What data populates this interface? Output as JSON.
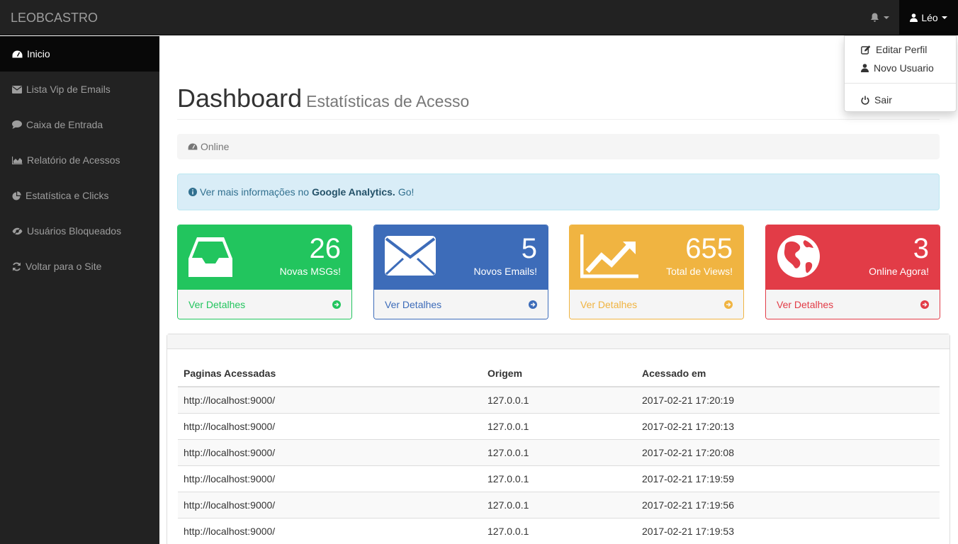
{
  "navbar": {
    "brand": "LEOBCASTRO",
    "user_label": "Léo"
  },
  "user_menu": {
    "items": [
      {
        "label": "Editar Perfil",
        "icon": "edit-icon"
      },
      {
        "label": "Novo Usuario",
        "icon": "user-icon"
      },
      {
        "label": "Sair",
        "icon": "power-icon"
      }
    ]
  },
  "sidebar": {
    "items": [
      {
        "label": "Inicio",
        "icon": "dashboard-icon",
        "active": true
      },
      {
        "label": "Lista Vip de Emails",
        "icon": "envelope-icon"
      },
      {
        "label": "Caixa de Entrada",
        "icon": "comment-icon"
      },
      {
        "label": "Relatório de Acessos",
        "icon": "area-chart-icon"
      },
      {
        "label": "Estatística e Clicks",
        "icon": "pie-chart-icon"
      },
      {
        "label": "Usuários Bloqueados",
        "icon": "eye-slash-icon"
      },
      {
        "label": "Voltar para o Site",
        "icon": "refresh-icon"
      }
    ]
  },
  "header": {
    "title": "Dashboard",
    "subtitle": "Estatísticas de Acesso"
  },
  "breadcrumb": {
    "label": "Online"
  },
  "alert": {
    "prefix": "Ver mais informações no",
    "strong": "Google Analytics.",
    "link": "Go!"
  },
  "panels": [
    {
      "value": "26",
      "label": "Novas MSGs!",
      "footer": "Ver Detalhes",
      "color": "#22c55e",
      "icon": "inbox-icon"
    },
    {
      "value": "5",
      "label": "Novos Emails!",
      "footer": "Ver Detalhes",
      "color": "#3d6cb9",
      "icon": "envelope-icon"
    },
    {
      "value": "655",
      "label": "Total de Views!",
      "footer": "Ver Detalhes",
      "color": "#f0b441",
      "icon": "line-chart-icon"
    },
    {
      "value": "3",
      "label": "Online Agora!",
      "footer": "Ver Detalhes",
      "color": "#e23c47",
      "icon": "globe-icon"
    }
  ],
  "access_table": {
    "columns": [
      "Paginas Acessadas",
      "Origem",
      "Acessado em"
    ],
    "rows": [
      [
        "http://localhost:9000/",
        "127.0.0.1",
        "2017-02-21 17:20:19"
      ],
      [
        "http://localhost:9000/",
        "127.0.0.1",
        "2017-02-21 17:20:13"
      ],
      [
        "http://localhost:9000/",
        "127.0.0.1",
        "2017-02-21 17:20:08"
      ],
      [
        "http://localhost:9000/",
        "127.0.0.1",
        "2017-02-21 17:19:59"
      ],
      [
        "http://localhost:9000/",
        "127.0.0.1",
        "2017-02-21 17:19:56"
      ],
      [
        "http://localhost:9000/",
        "127.0.0.1",
        "2017-02-21 17:19:53"
      ]
    ]
  }
}
